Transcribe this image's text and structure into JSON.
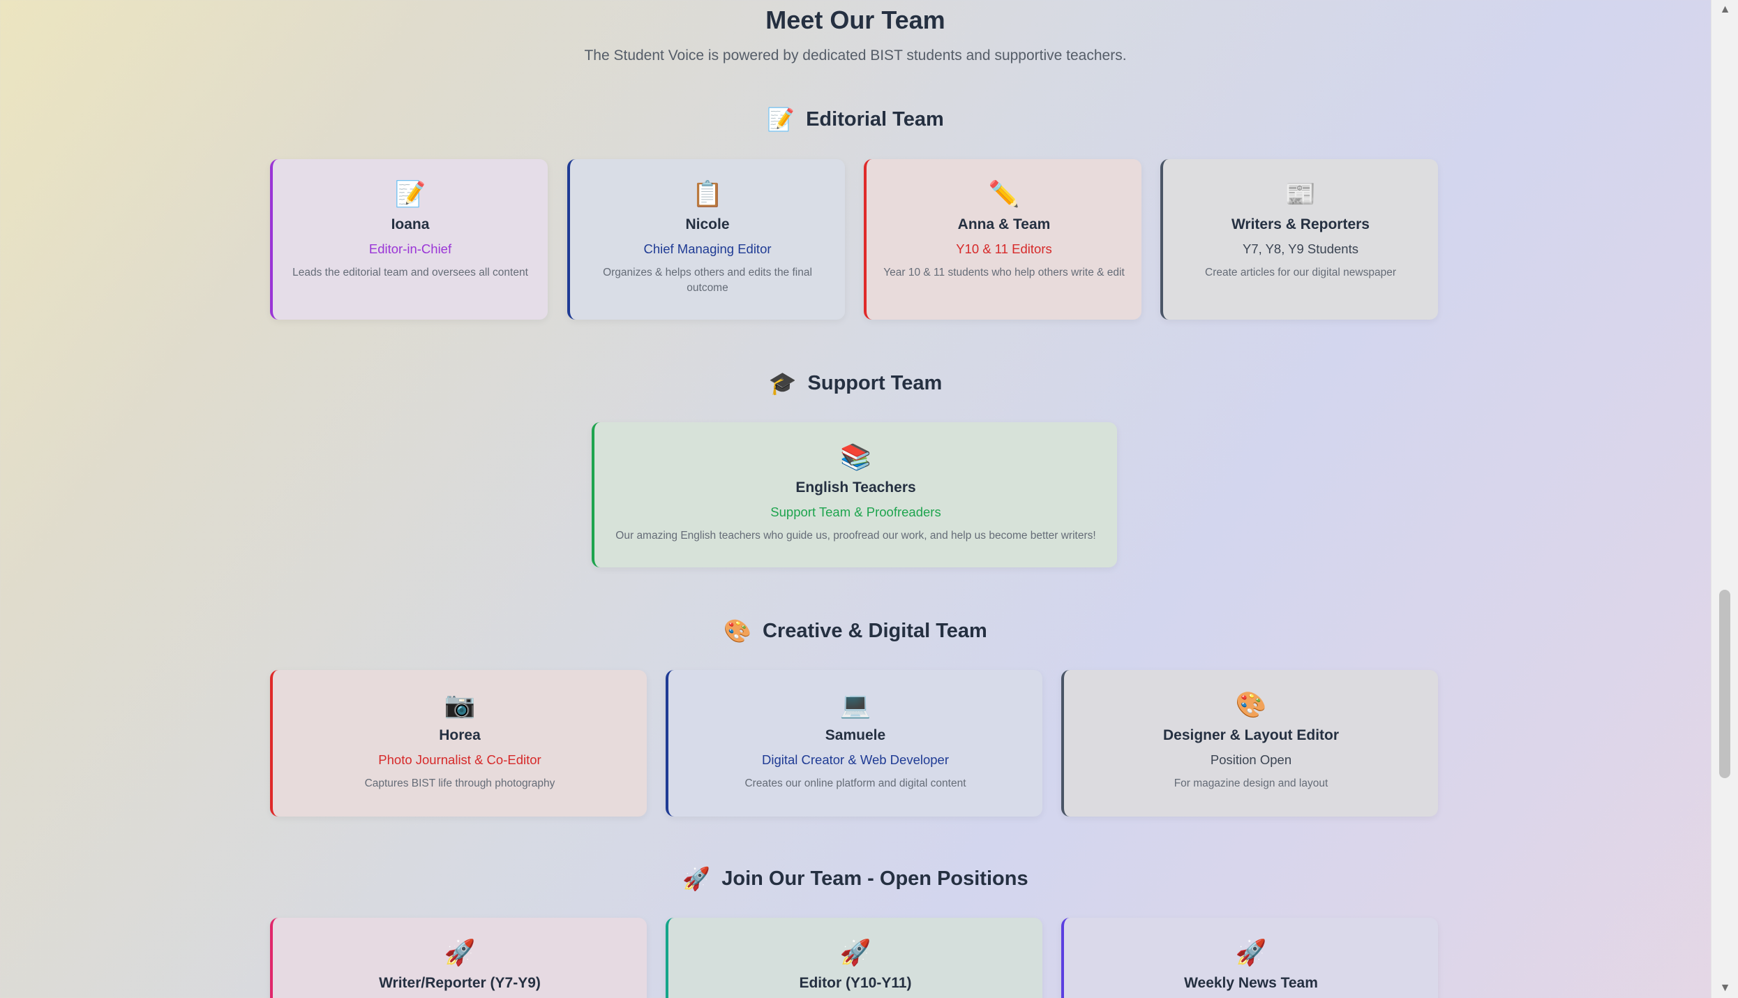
{
  "header": {
    "title": "Meet Our Team",
    "subtitle": "The Student Voice is powered by dedicated BIST students and supportive teachers."
  },
  "sections": {
    "editorial": {
      "icon": "📝",
      "title": "Editorial Team"
    },
    "support": {
      "icon": "🎓",
      "title": "Support Team"
    },
    "creative": {
      "icon": "🎨",
      "title": "Creative & Digital Team"
    },
    "join": {
      "icon": "🚀",
      "title": "Join Our Team - Open Positions"
    }
  },
  "editorial_members": [
    {
      "icon": "📝",
      "name": "Ioana",
      "role": "Editor-in-Chief",
      "desc": "Leads the editorial team and oversees all content"
    },
    {
      "icon": "📋",
      "name": "Nicole",
      "role": "Chief Managing Editor",
      "desc": "Organizes & helps others and edits the final outcome"
    },
    {
      "icon": "✏️",
      "name": "Anna & Team",
      "role": "Y10 & 11 Editors",
      "desc": "Year 10 & 11 students who help others write & edit"
    },
    {
      "icon": "📰",
      "name": "Writers & Reporters",
      "role": "Y7, Y8, Y9 Students",
      "desc": "Create articles for our digital newspaper"
    }
  ],
  "support_members": [
    {
      "icon": "📚",
      "name": "English Teachers",
      "role": "Support Team & Proofreaders",
      "desc": "Our amazing English teachers who guide us, proofread our work, and help us become better writers!"
    }
  ],
  "creative_members": [
    {
      "icon": "📷",
      "name": "Horea",
      "role": "Photo Journalist & Co-Editor",
      "desc": "Captures BIST life through photography"
    },
    {
      "icon": "💻",
      "name": "Samuele",
      "role": "Digital Creator & Web Developer",
      "desc": "Creates our online platform and digital content"
    },
    {
      "icon": "🎨",
      "name": "Designer & Layout Editor",
      "role": "Position Open",
      "desc": "For magazine design and layout"
    }
  ],
  "open_positions": [
    {
      "icon": "🚀",
      "name": "Writer/Reporter (Y7-Y9)"
    },
    {
      "icon": "🚀",
      "name": "Editor (Y10-Y11)"
    },
    {
      "icon": "🚀",
      "name": "Weekly News Team"
    }
  ],
  "colors": {
    "editor_in_chief": "#9a35d6",
    "managing_editor": "#1f3b94",
    "y10_editors": "#df2a2a",
    "writers": "#4a5566",
    "support": "#1ea44e",
    "open_writer": "#e0276b",
    "open_editor": "#14a58a",
    "open_weekly": "#5b3fe0"
  }
}
